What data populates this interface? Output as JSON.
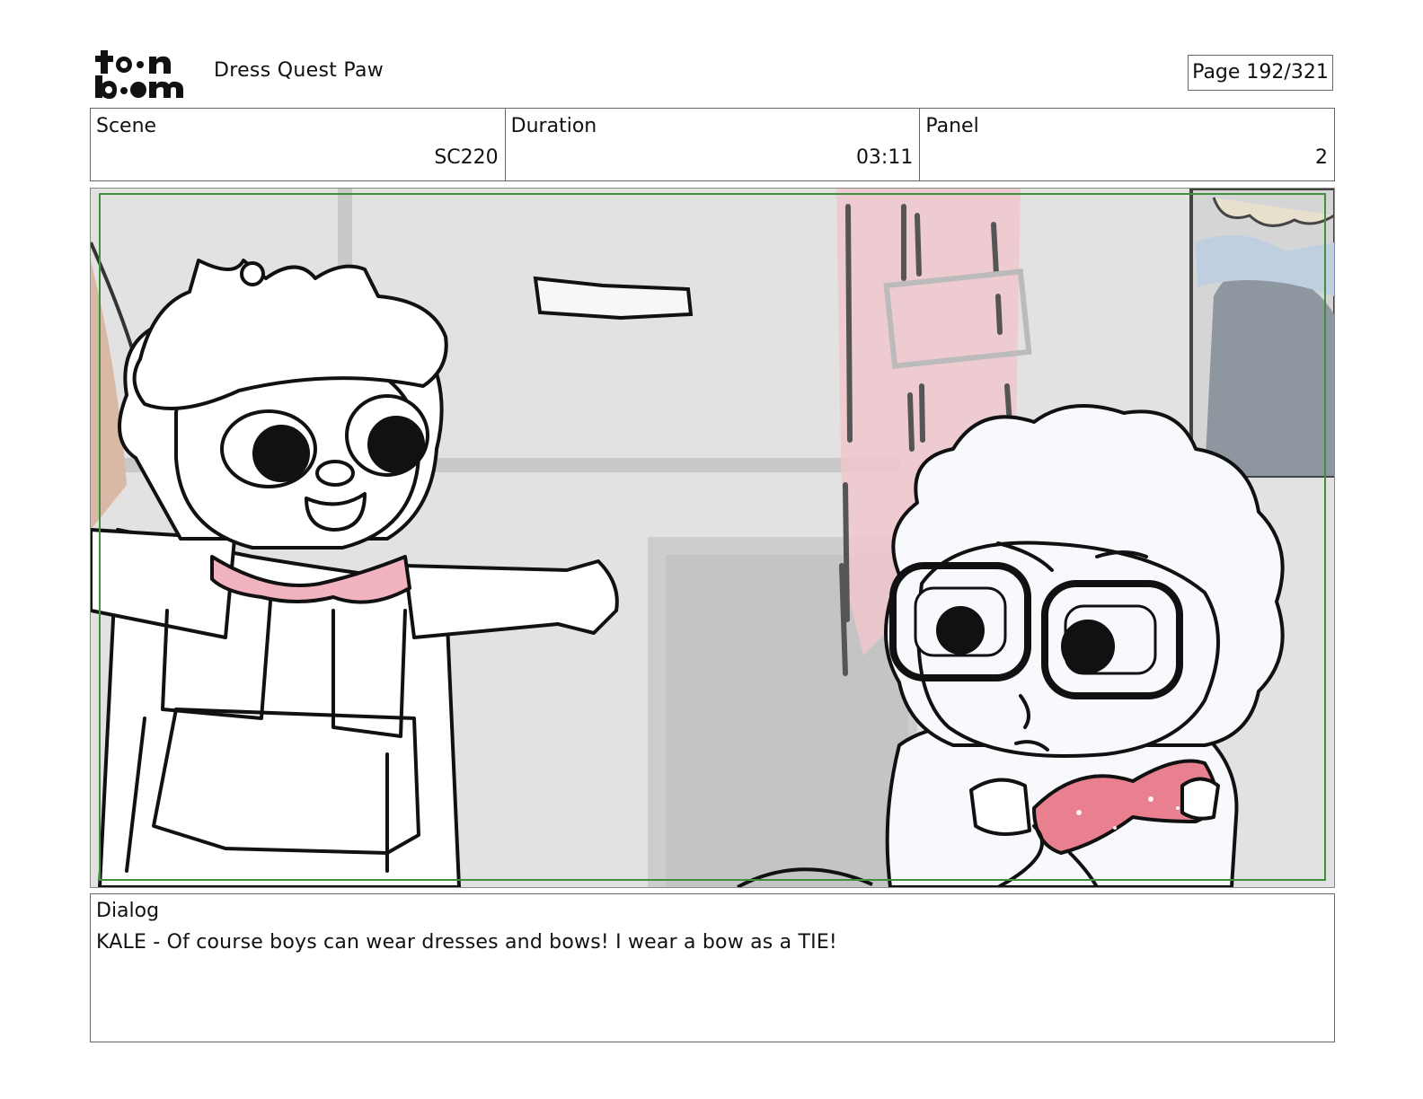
{
  "header": {
    "logo_text": "toon boom",
    "project_title": "Dress Quest Paw",
    "page_label": "Page 192/321"
  },
  "info": {
    "scene_label": "Scene",
    "scene_value": "SC220",
    "duration_label": "Duration",
    "duration_value": "03:11",
    "panel_label": "Panel",
    "panel_value": "2"
  },
  "panel_image": {
    "icon": "storyboard-drawing",
    "safe_frame_color": "#3f8f3f",
    "accent_pink": "#e8808f"
  },
  "dialog": {
    "label": "Dialog",
    "text": "KALE - Of course boys can wear dresses and bows! I wear a bow as a TIE!"
  }
}
